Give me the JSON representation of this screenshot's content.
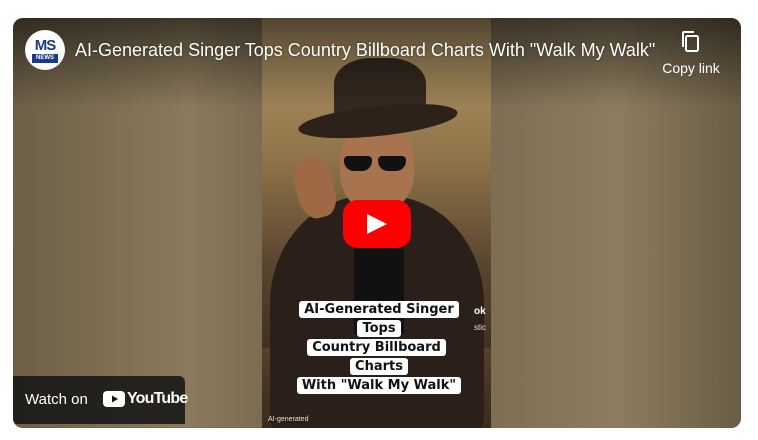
{
  "header": {
    "channel_logo_text": "MS",
    "channel_logo_sub": "NEWS",
    "title": "AI-Generated Singer Tops Country Billboard Charts With \"Walk My Walk\"",
    "copy_link_label": "Copy link"
  },
  "video": {
    "caption_lines": [
      "AI-Generated Singer Tops",
      "Country Billboard Charts",
      "With \"Walk My Walk\""
    ],
    "side_text_1": "ok",
    "side_text_2": "stic",
    "watermark": "AI-generated"
  },
  "footer": {
    "watch_on_label": "Watch on",
    "youtube_label": "YouTube"
  },
  "colors": {
    "play_button": "#ff0000",
    "brand_blue": "#1a3a8c"
  },
  "icons": [
    "channel-logo",
    "copy-icon",
    "play-icon",
    "youtube-logo-icon"
  ]
}
